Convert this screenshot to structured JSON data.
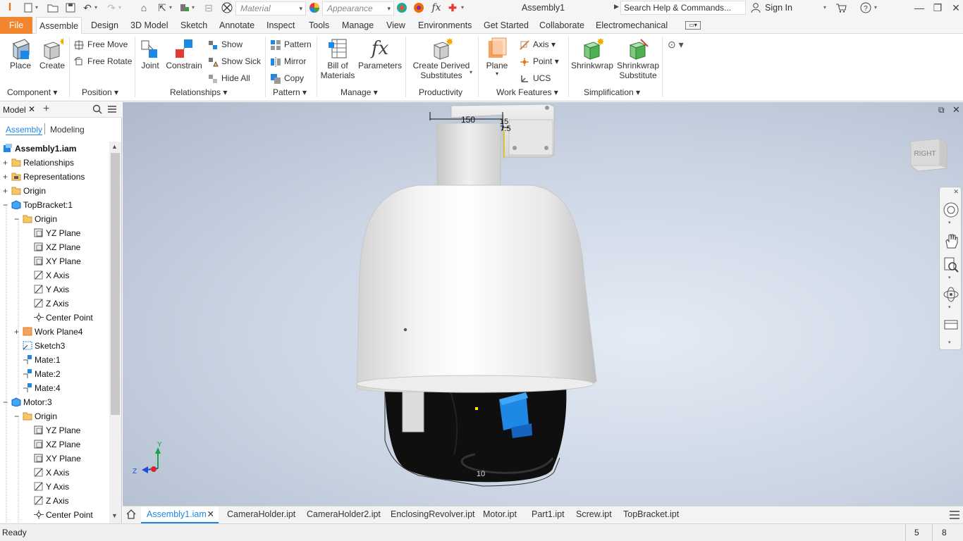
{
  "qat": {
    "material_placeholder": "Material",
    "appearance_placeholder": "Appearance",
    "doc_title": "Assembly1",
    "search_placeholder": "Search Help & Commands...",
    "sign_in": "Sign In"
  },
  "tabs": [
    "File",
    "Assemble",
    "Design",
    "3D Model",
    "Sketch",
    "Annotate",
    "Inspect",
    "Tools",
    "Manage",
    "View",
    "Environments",
    "Get Started",
    "Collaborate",
    "Electromechanical"
  ],
  "ribbon": {
    "place": "Place",
    "create": "Create",
    "free_move": "Free Move",
    "free_rotate": "Free Rotate",
    "joint": "Joint",
    "constrain": "Constrain",
    "show": "Show",
    "show_sick": "Show Sick",
    "hide_all": "Hide All",
    "pattern": "Pattern",
    "mirror": "Mirror",
    "copy": "Copy",
    "bom_line1": "Bill of",
    "bom_line2": "Materials",
    "parameters": "Parameters",
    "derived_line1": "Create Derived",
    "derived_line2": "Substitutes",
    "plane": "Plane",
    "axis": "Axis",
    "point": "Point",
    "ucs": "UCS",
    "shrinkwrap": "Shrinkwrap",
    "shrink_sub_line1": "Shrinkwrap",
    "shrink_sub_line2": "Substitute",
    "panels": {
      "component": "Component",
      "position": "Position",
      "relationships": "Relationships",
      "pattern": "Pattern",
      "manage": "Manage",
      "productivity": "Productivity",
      "work_features": "Work Features",
      "simplification": "Simplification"
    }
  },
  "browser": {
    "title": "Model",
    "tab_assembly": "Assembly",
    "tab_modeling": "Modeling",
    "tree": [
      {
        "label": "Assembly1.iam",
        "bold": true,
        "icon": "assembly",
        "exp": "",
        "level": 0
      },
      {
        "label": "Relationships",
        "icon": "folder",
        "exp": "+",
        "level": 0
      },
      {
        "label": "Representations",
        "icon": "folder-rep",
        "exp": "+",
        "level": 0
      },
      {
        "label": "Origin",
        "icon": "folder",
        "exp": "+",
        "level": 0
      },
      {
        "label": "TopBracket:1",
        "icon": "part",
        "exp": "-",
        "level": 0
      },
      {
        "label": "Origin",
        "icon": "folder",
        "exp": "-",
        "level": 1
      },
      {
        "label": "YZ Plane",
        "icon": "plane",
        "exp": "",
        "level": 2
      },
      {
        "label": "XZ Plane",
        "icon": "plane",
        "exp": "",
        "level": 2
      },
      {
        "label": "XY Plane",
        "icon": "plane",
        "exp": "",
        "level": 2
      },
      {
        "label": "X Axis",
        "icon": "axis",
        "exp": "",
        "level": 2
      },
      {
        "label": "Y Axis",
        "icon": "axis",
        "exp": "",
        "level": 2
      },
      {
        "label": "Z Axis",
        "icon": "axis",
        "exp": "",
        "level": 2
      },
      {
        "label": "Center Point",
        "icon": "point",
        "exp": "",
        "level": 2
      },
      {
        "label": "Work Plane4",
        "icon": "workplane",
        "exp": "+",
        "level": 1
      },
      {
        "label": "Sketch3",
        "icon": "sketch",
        "exp": "",
        "level": 1
      },
      {
        "label": "Mate:1",
        "icon": "mate",
        "exp": "",
        "level": 1
      },
      {
        "label": "Mate:2",
        "icon": "mate",
        "exp": "",
        "level": 1
      },
      {
        "label": "Mate:4",
        "icon": "mate",
        "exp": "",
        "level": 1
      },
      {
        "label": "Motor:3",
        "icon": "part",
        "exp": "-",
        "level": 0
      },
      {
        "label": "Origin",
        "icon": "folder",
        "exp": "-",
        "level": 1
      },
      {
        "label": "YZ Plane",
        "icon": "plane",
        "exp": "",
        "level": 2
      },
      {
        "label": "XZ Plane",
        "icon": "plane",
        "exp": "",
        "level": 2
      },
      {
        "label": "XY Plane",
        "icon": "plane",
        "exp": "",
        "level": 2
      },
      {
        "label": "X Axis",
        "icon": "axis",
        "exp": "",
        "level": 2
      },
      {
        "label": "Y Axis",
        "icon": "axis",
        "exp": "",
        "level": 2
      },
      {
        "label": "Z Axis",
        "icon": "axis",
        "exp": "",
        "level": 2
      },
      {
        "label": "Center Point",
        "icon": "point",
        "exp": "",
        "level": 2
      }
    ]
  },
  "viewport": {
    "dim_150": "150",
    "dim_15": "15",
    "dim_7_5": "7.5",
    "dim_10": "10",
    "viewcube_label": "RIGHT",
    "triad_y": "Y",
    "triad_z": "Z"
  },
  "doc_tabs": [
    "Assembly1.iam",
    "CameraHolder.ipt",
    "CameraHolder2.ipt",
    "EnclosingRevolver.ipt",
    "Motor.ipt",
    "Part1.ipt",
    "Screw.ipt",
    "TopBracket.ipt"
  ],
  "status": {
    "text": "Ready",
    "count1": "5",
    "count2": "8"
  },
  "colors": {
    "file_tab": "#f2862e",
    "accent_blue": "#1e88e5",
    "viewport_bg": "#c9d3e2"
  }
}
